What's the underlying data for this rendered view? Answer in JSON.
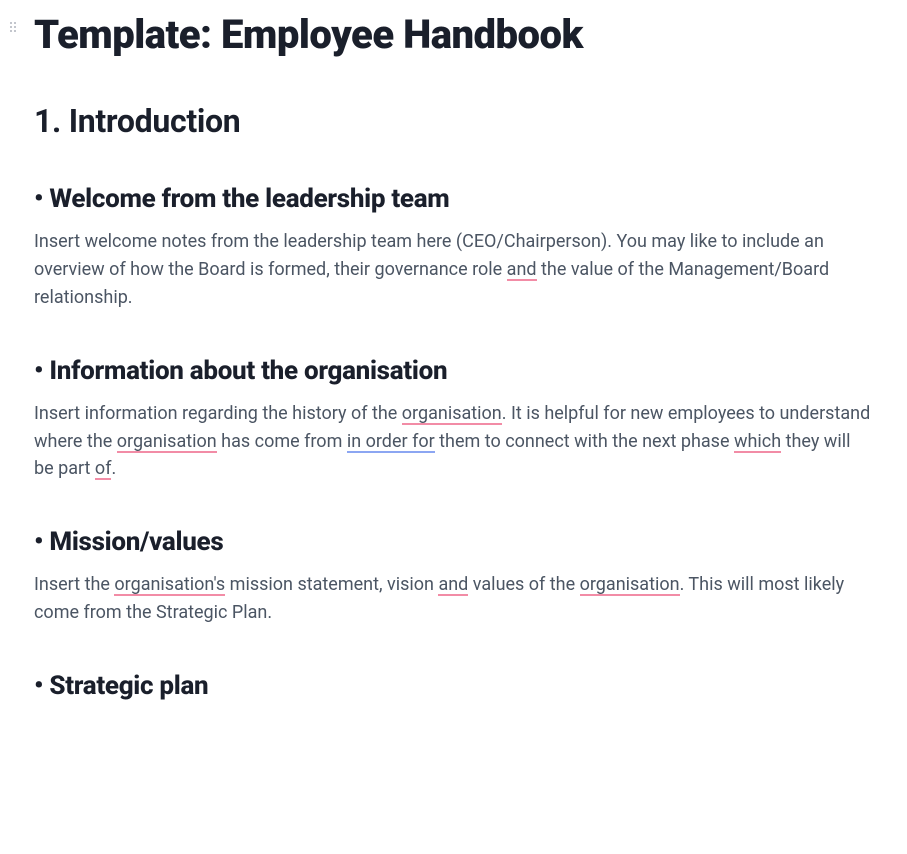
{
  "title": "Template: Employee Handbook",
  "section1": {
    "heading": "1. Introduction",
    "welcome": {
      "heading": "Welcome from the leadership team",
      "p_a": "Insert welcome notes from the leadership team here (CEO/Chairperson). You may like to include an overview of how the Board is formed, their governance role ",
      "p_hl1": "and",
      "p_b": " the value of the Management/Board relationship."
    },
    "info": {
      "heading": "Information about the organisation",
      "p_a": "Insert information regarding the history of the ",
      "p_hl1": "organisation",
      "p_b": ". It is helpful for new employees to understand where the ",
      "p_hl2": "organisation",
      "p_c": " has come from ",
      "p_hl3": "in order for",
      "p_d": " them to connect with the next phase ",
      "p_hl4": "which",
      "p_e": " they will be part ",
      "p_hl5": "of",
      "p_f": "."
    },
    "mission": {
      "heading": "Mission/values",
      "p_a": "Insert the ",
      "p_hl1": "organisation's",
      "p_b": " mission statement, vision ",
      "p_hl2": "and",
      "p_c": " values of the ",
      "p_hl3": "organisation",
      "p_d": ". This will most likely come from the Strategic Plan."
    },
    "strategic": {
      "heading": "Strategic plan"
    }
  }
}
